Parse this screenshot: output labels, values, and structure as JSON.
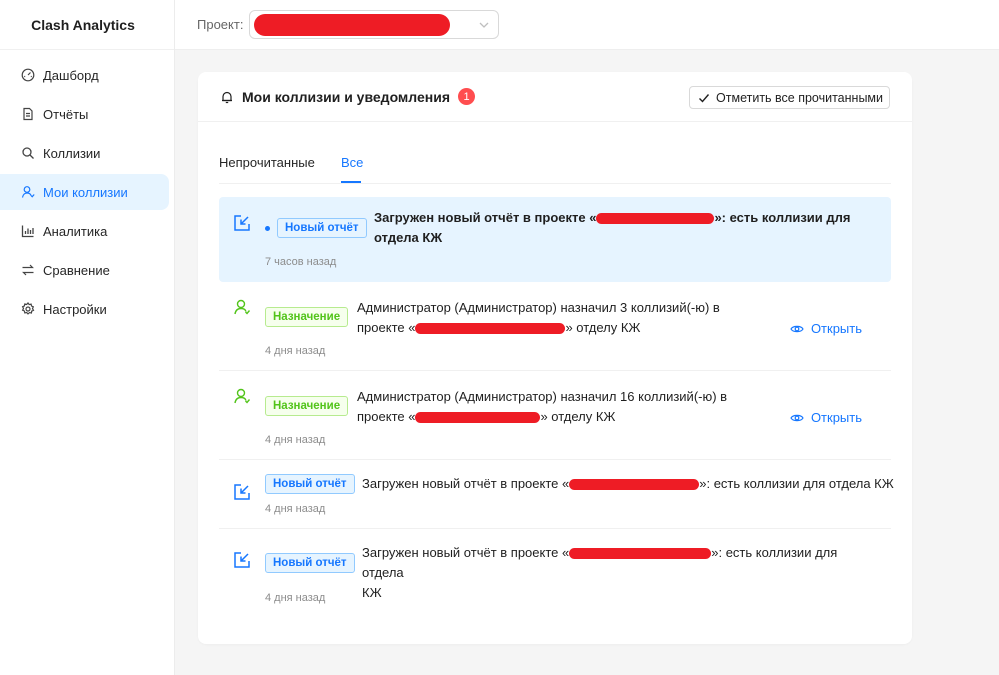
{
  "app": {
    "title": "Clash Analytics"
  },
  "sidebar": {
    "items": [
      {
        "label": "Дашборд",
        "icon": "dashboard-icon"
      },
      {
        "label": "Отчёты",
        "icon": "document-icon"
      },
      {
        "label": "Коллизии",
        "icon": "search-icon"
      },
      {
        "label": "Мои коллизии",
        "icon": "user-icon",
        "active": true
      },
      {
        "label": "Аналитика",
        "icon": "bar-chart-icon"
      },
      {
        "label": "Сравнение",
        "icon": "swap-icon"
      },
      {
        "label": "Настройки",
        "icon": "gear-icon"
      }
    ]
  },
  "topbar": {
    "project_label": "Проект:"
  },
  "panel": {
    "title": "Мои коллизии и уведомления",
    "unread_count": "1",
    "mark_all_label": "Отметить все прочитанными"
  },
  "tabs": [
    {
      "label": "Непрочитанные"
    },
    {
      "label": "Все",
      "active": true
    }
  ],
  "notifications": [
    {
      "type": "report",
      "tag": "Новый отчёт",
      "unread": true,
      "text_before": "Загружен новый отчёт в проекте «",
      "text_after": "»: есть коллизии для",
      "text_line2": "отдела КЖ",
      "time": "7 часов назад"
    },
    {
      "type": "assign",
      "tag": "Назначение",
      "text_line1": "Администратор (Администратор) назначил 3 коллизий(-ю) в",
      "text_before": "проекте «",
      "text_after": "» отделу КЖ",
      "time": "4 дня назад",
      "action": "Открыть"
    },
    {
      "type": "assign",
      "tag": "Назначение",
      "text_line1": "Администратор (Администратор) назначил 16 коллизий(-ю) в",
      "text_before": "проекте «",
      "text_after": "» отделу КЖ",
      "time": "4 дня назад",
      "action": "Открыть"
    },
    {
      "type": "report",
      "tag": "Новый отчёт",
      "text_before": "Загружен новый отчёт в проекте «",
      "text_after": "»: есть коллизии для отдела КЖ",
      "time": "4 дня назад"
    },
    {
      "type": "report",
      "tag": "Новый отчёт",
      "text_before": "Загружен новый отчёт в проекте «",
      "text_after": "»: есть коллизии для отдела",
      "text_line2": "КЖ",
      "time": "4 дня назад"
    }
  ],
  "colors": {
    "accent": "#1677ff",
    "success": "#52c41a",
    "danger": "#ff4d4f",
    "redaction": "#ee1c25"
  }
}
